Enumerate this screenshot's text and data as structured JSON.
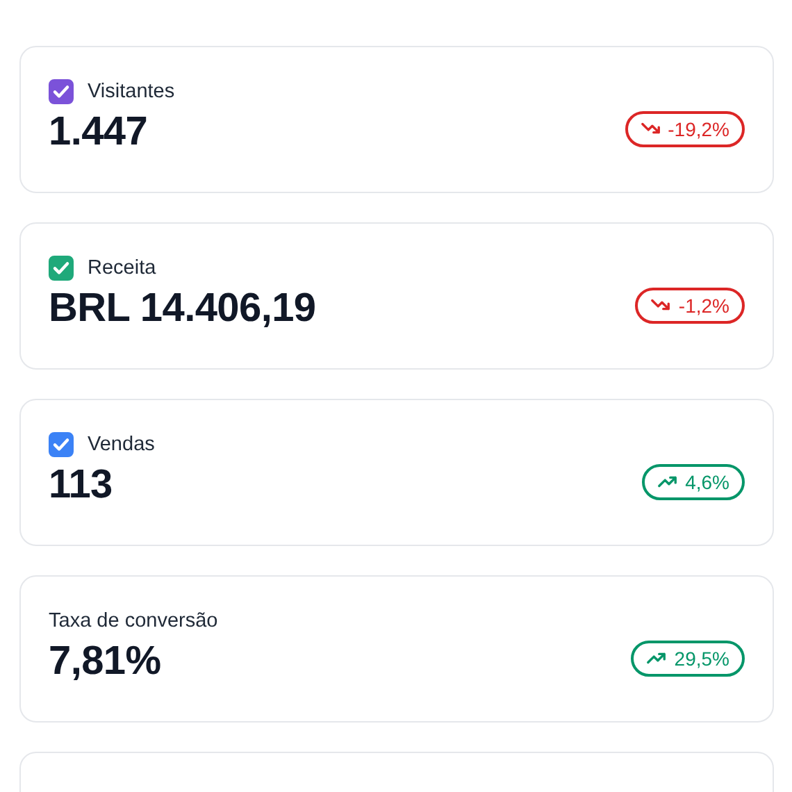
{
  "metrics": [
    {
      "label": "Visitantes",
      "checkbox": {
        "checked": true,
        "color": "#7b52d9"
      },
      "value": "1.447",
      "change": {
        "kind": "down",
        "text": "-19,2%"
      }
    },
    {
      "label": "Receita",
      "checkbox": {
        "checked": true,
        "color": "#1fa97a"
      },
      "value": "BRL 14.406,19",
      "change": {
        "kind": "down",
        "text": "-1,2%"
      }
    },
    {
      "label": "Vendas",
      "checkbox": {
        "checked": true,
        "color": "#3b82f6"
      },
      "value": "113",
      "change": {
        "kind": "up",
        "text": "4,6%"
      }
    },
    {
      "label": "Taxa de conversão",
      "value": "7,81%",
      "change": {
        "kind": "up",
        "text": "29,5%"
      }
    }
  ]
}
